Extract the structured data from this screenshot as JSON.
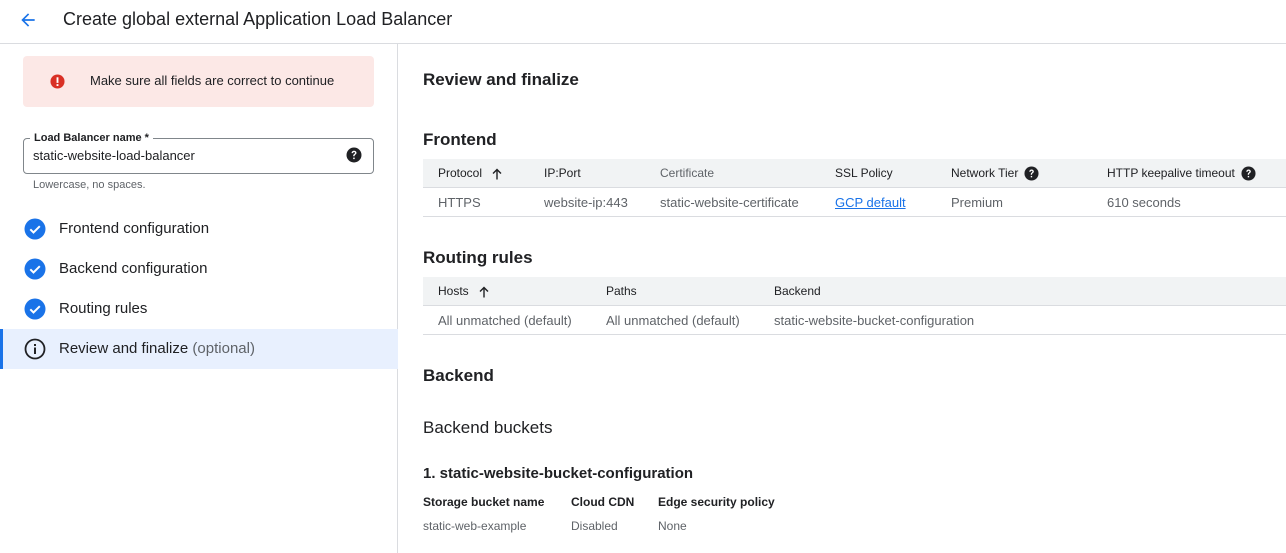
{
  "header": {
    "title": "Create global external Application Load Balancer",
    "back_icon": "arrow-back-icon"
  },
  "left": {
    "error_banner": {
      "text": "Make sure all fields are correct to continue",
      "icon": "error-icon"
    },
    "name_field": {
      "label": "Load Balancer name *",
      "value": "static-website-load-balancer",
      "hint": "Lowercase, no spaces."
    },
    "steps": [
      {
        "label": "Frontend configuration",
        "state": "complete"
      },
      {
        "label": "Backend configuration",
        "state": "complete"
      },
      {
        "label": "Routing rules",
        "state": "complete"
      },
      {
        "label": "Review and finalize",
        "suffix": "(optional)",
        "state": "active"
      }
    ]
  },
  "main": {
    "heading": "Review and finalize",
    "frontend": {
      "title": "Frontend",
      "columns": [
        "Protocol",
        "IP:Port",
        "Certificate",
        "SSL Policy",
        "Network Tier",
        "HTTP keepalive timeout"
      ],
      "rows": [
        [
          "HTTPS",
          "website-ip:443",
          "static-website-certificate",
          "GCP default",
          "Premium",
          "610 seconds"
        ]
      ]
    },
    "routing": {
      "title": "Routing rules",
      "columns": [
        "Hosts",
        "Paths",
        "Backend"
      ],
      "rows": [
        [
          "All unmatched (default)",
          "All unmatched (default)",
          "static-website-bucket-configuration"
        ]
      ]
    },
    "backend": {
      "title": "Backend",
      "subtitle": "Backend buckets",
      "bucket_title": "1. static-website-bucket-configuration",
      "labels": [
        "Storage bucket name",
        "Cloud CDN",
        "Edge security policy"
      ],
      "values": [
        "static-web-example",
        "Disabled",
        "None"
      ]
    }
  },
  "colors": {
    "accent": "#1a73e8",
    "check": "#1a73e8",
    "error": "#d93025",
    "error_bg": "#fce8e6",
    "active_bg": "#e8f0fe"
  }
}
